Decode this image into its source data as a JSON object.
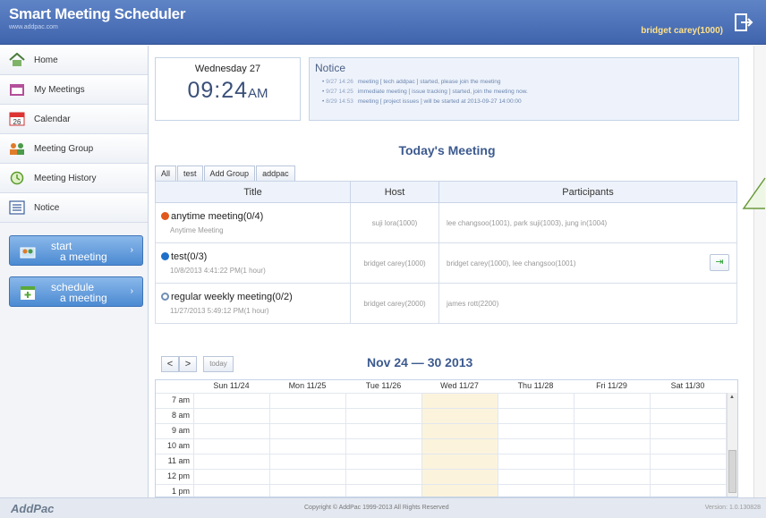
{
  "header": {
    "title": "Smart Meeting Scheduler",
    "subtitle": "www.addpac.com",
    "user": "bridget carey(1000)"
  },
  "sidebar": {
    "items": [
      {
        "label": "Home",
        "icon": "home-icon"
      },
      {
        "label": "My Meetings",
        "icon": "meetings-icon"
      },
      {
        "label": "Calendar",
        "icon": "calendar-icon",
        "badge": "26"
      },
      {
        "label": "Meeting Group",
        "icon": "group-icon"
      },
      {
        "label": "Meeting History",
        "icon": "history-icon"
      },
      {
        "label": "Notice",
        "icon": "notice-icon"
      }
    ],
    "actions": [
      {
        "line1": "start",
        "line2": "a meeting"
      },
      {
        "line1": "schedule",
        "line2": "a meeting"
      }
    ]
  },
  "clock": {
    "day": "Wednesday 27",
    "time": "09:24",
    "ampm": "AM"
  },
  "notice": {
    "heading": "Notice",
    "items": [
      {
        "date": "9/27 14:26",
        "text": "meeting [ tech addpac ] started, please join the meeting"
      },
      {
        "date": "9/27 14:25",
        "text": "immediate meeting [ issue tracking ] started, join the meeting now."
      },
      {
        "date": "8/29 14:53",
        "text": "meeting [ project issues ] will be started at 2013-09-27 14:00:00"
      }
    ]
  },
  "today": {
    "title": "Today's Meeting",
    "tabs": [
      "All",
      "test",
      "Add Group",
      "addpac"
    ],
    "columns": [
      "Title",
      "Host",
      "Participants"
    ],
    "rows": [
      {
        "title": "anytime meeting(0/4)",
        "sub": "Anytime Meeting",
        "host": "suji lora(1000)",
        "participants": "lee changsoo(1001), park suji(1003), jung in(1004)",
        "dot_color": "#e0581c",
        "join": false
      },
      {
        "title": "test(0/3)",
        "sub": "10/8/2013 4:41:22 PM(1 hour)",
        "host": "bridget carey(1000)",
        "participants": "bridget carey(1000), lee changsoo(1001)",
        "dot_color": "#1f6fc9",
        "join": true
      },
      {
        "title": "regular weekly meeting(0/2)",
        "sub": "11/27/2013 5:49:12 PM(1 hour)",
        "host": "bridget carey(2000)",
        "participants": "james rott(2200)",
        "dot_color": "#6e8fb8",
        "join": false
      }
    ]
  },
  "calendar": {
    "prev": "<",
    "next": ">",
    "today_label": "today",
    "range": "Nov 24 — 30 2013",
    "days": [
      "Sun 11/24",
      "Mon 11/25",
      "Tue 11/26",
      "Wed 11/27",
      "Thu 11/28",
      "Fri 11/29",
      "Sat 11/30"
    ],
    "hours": [
      "7 am",
      "8 am",
      "9 am",
      "10 am",
      "11 am",
      "12 pm",
      "1 pm"
    ]
  },
  "footer": {
    "brand": "AddPac",
    "copyright": "Copyright © AddPac 1999-2013 All Rights Reserved",
    "version": "Version: 1.0.130828"
  }
}
